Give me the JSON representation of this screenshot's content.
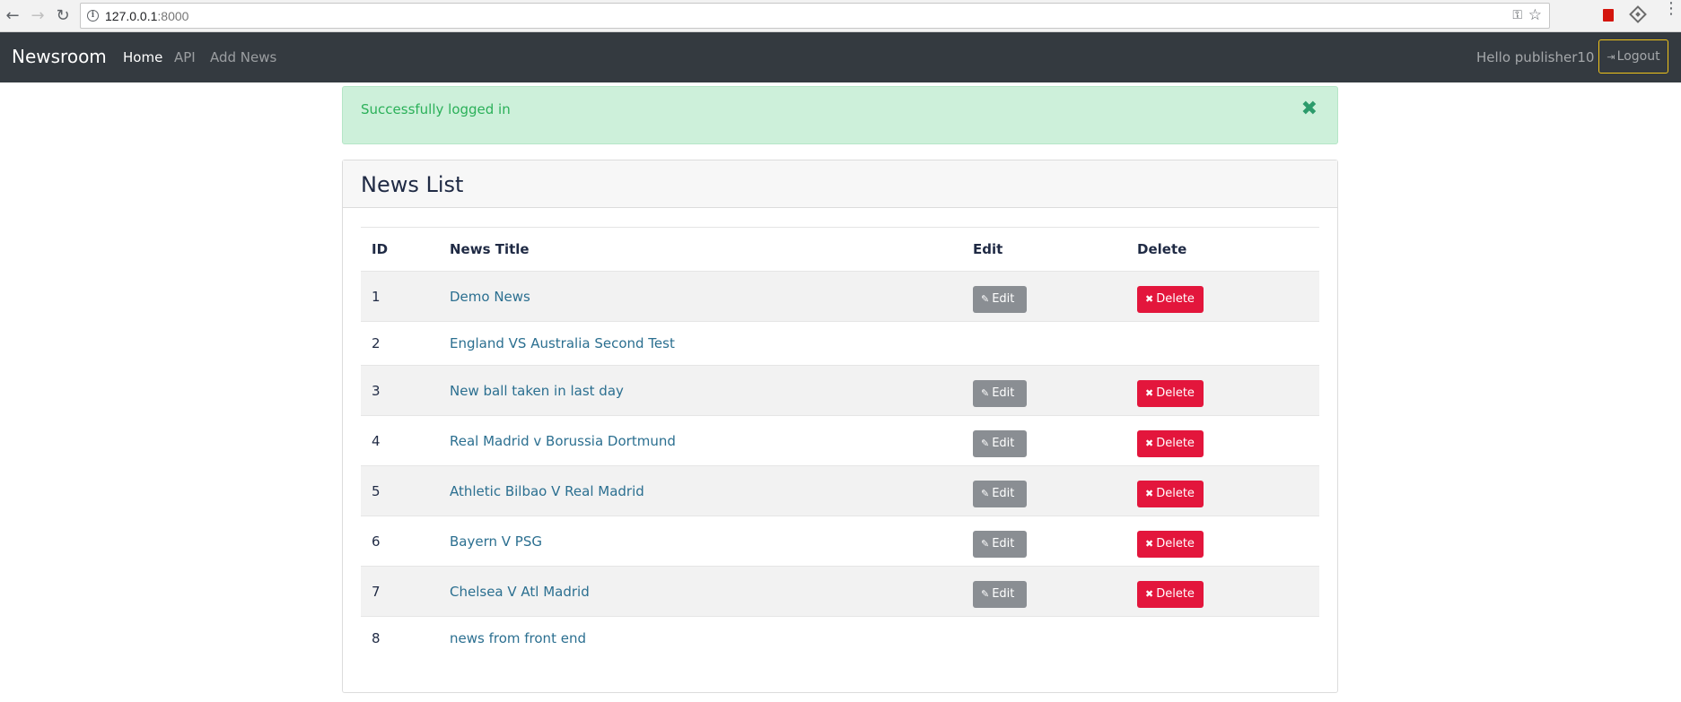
{
  "browser": {
    "url_host": "127.0.0.1",
    "url_port": ":8000"
  },
  "navbar": {
    "brand": "Newsroom",
    "links": [
      {
        "label": "Home",
        "active": true
      },
      {
        "label": "API",
        "active": false
      },
      {
        "label": "Add News",
        "active": false
      }
    ],
    "greeting": "Hello publisher10",
    "logout_label": "Logout"
  },
  "alert": {
    "message": "Successfully logged in",
    "close_glyph": "✖"
  },
  "card": {
    "title": "News List",
    "columns": [
      "ID",
      "News Title",
      "Edit",
      "Delete"
    ],
    "edit_label": "Edit",
    "delete_label": "Delete",
    "rows": [
      {
        "id": "1",
        "title": "Demo News",
        "actions": true
      },
      {
        "id": "2",
        "title": "England VS Australia Second Test",
        "actions": false
      },
      {
        "id": "3",
        "title": "New ball taken in last day",
        "actions": true
      },
      {
        "id": "4",
        "title": "Real Madrid v Borussia Dortmund",
        "actions": true
      },
      {
        "id": "5",
        "title": "Athletic Bilbao V Real Madrid",
        "actions": true
      },
      {
        "id": "6",
        "title": "Bayern V PSG",
        "actions": true
      },
      {
        "id": "7",
        "title": "Chelsea V Atl Madrid",
        "actions": true
      },
      {
        "id": "8",
        "title": "news from front end",
        "actions": false
      }
    ]
  },
  "colors": {
    "navbar_bg": "#343a40",
    "alert_bg": "#cdf0da",
    "alert_text": "#2bb059",
    "link": "#2b6f90",
    "edit_btn": "#8a8e93",
    "delete_btn": "#e3163c"
  }
}
